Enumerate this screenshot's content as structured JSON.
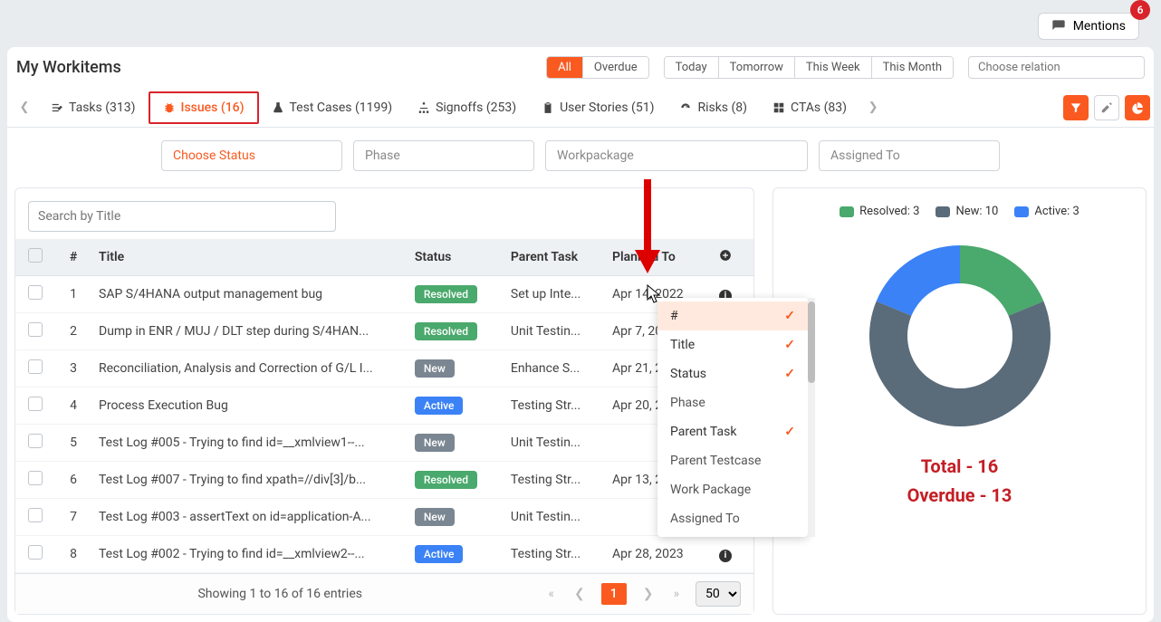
{
  "badge_count": "6",
  "mentions_label": "Mentions",
  "page_title": "My Workitems",
  "time_filters": {
    "all": "All",
    "overdue": "Overdue",
    "today": "Today",
    "tomorrow": "Tomorrow",
    "this_week": "This Week",
    "this_month": "This Month"
  },
  "relation_placeholder": "Choose relation",
  "tabs": {
    "tasks": "Tasks (313)",
    "issues": "Issues (16)",
    "testcases": "Test Cases (1199)",
    "signoffs": "Signoffs (253)",
    "userstories": "User Stories (51)",
    "risks": "Risks (8)",
    "ctas": "CTAs (83)"
  },
  "filters": {
    "status": "Choose Status",
    "phase": "Phase",
    "workpackage": "Workpackage",
    "assigned": "Assigned To"
  },
  "search_placeholder": "Search by Title",
  "columns": {
    "num": "#",
    "title": "Title",
    "status": "Status",
    "parent": "Parent Task",
    "planned": "Planned To"
  },
  "rows": [
    {
      "n": "1",
      "title": "SAP S/4HANA output management bug",
      "status": "Resolved",
      "parent": "Set up Inte...",
      "planned": "Apr 14, 2022"
    },
    {
      "n": "2",
      "title": "Dump in ENR / MUJ / DLT step during S/4HAN...",
      "status": "Resolved",
      "parent": "Unit Testin...",
      "planned": "Apr 7, 2022"
    },
    {
      "n": "3",
      "title": "Reconciliation, Analysis and Correction of G/L I...",
      "status": "New",
      "parent": "Enhance S...",
      "planned": "Apr 21, 2022"
    },
    {
      "n": "4",
      "title": "Process Execution Bug",
      "status": "Active",
      "parent": "Testing Str...",
      "planned": "Apr 20, 2022"
    },
    {
      "n": "5",
      "title": "Test Log #005 - Trying to find id=__xmlview1--...",
      "status": "New",
      "parent": "Unit Testin...",
      "planned": ""
    },
    {
      "n": "6",
      "title": "Test Log #007 - Trying to find xpath=//div[3]/b...",
      "status": "Resolved",
      "parent": "Testing Str...",
      "planned": "Apr 13, 2023"
    },
    {
      "n": "7",
      "title": "Test Log #003 - assertText on id=application-A...",
      "status": "New",
      "parent": "Unit Testin...",
      "planned": ""
    },
    {
      "n": "8",
      "title": "Test Log #002 - Trying to find id=__xmlview2--...",
      "status": "Active",
      "parent": "Testing Str...",
      "planned": "Apr 28, 2023"
    }
  ],
  "pager": {
    "entries": "Showing 1 to 16 of 16 entries",
    "page": "1",
    "perpage": "50"
  },
  "legend": {
    "resolved": "Resolved: 3",
    "new": "New: 10",
    "active": "Active: 3"
  },
  "totals": {
    "total": "Total - 16",
    "overdue": "Overdue - 13"
  },
  "column_picker": [
    {
      "label": "#",
      "selected": true,
      "hover": true
    },
    {
      "label": "Title",
      "selected": true
    },
    {
      "label": "Status",
      "selected": true
    },
    {
      "label": "Phase",
      "selected": false
    },
    {
      "label": "Parent Task",
      "selected": true
    },
    {
      "label": "Parent Testcase",
      "selected": false
    },
    {
      "label": "Work Package",
      "selected": false
    },
    {
      "label": "Assigned To",
      "selected": false
    }
  ],
  "chart_data": {
    "type": "pie",
    "title": "",
    "series": [
      {
        "name": "Resolved",
        "value": 3,
        "color": "#4aa96c"
      },
      {
        "name": "New",
        "value": 10,
        "color": "#5a6b7a"
      },
      {
        "name": "Active",
        "value": 3,
        "color": "#3b82f6"
      }
    ],
    "total": 16,
    "overdue": 13,
    "donut_inner_radius_ratio": 0.58
  },
  "colors": {
    "accent": "#fa5a20",
    "danger": "#c41e25",
    "resolved": "#4aa96c",
    "new": "#5a6b7a",
    "active": "#3b82f6"
  }
}
